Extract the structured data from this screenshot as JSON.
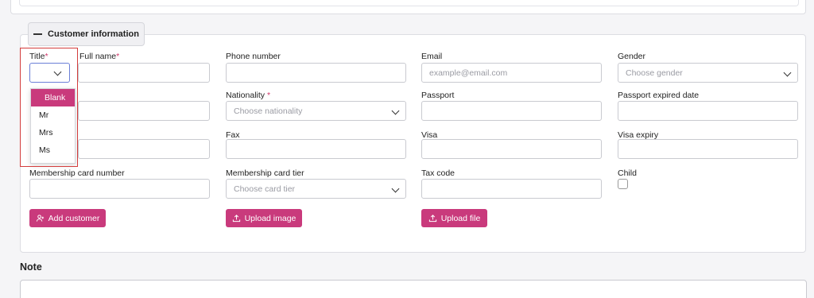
{
  "section": {
    "title": "Customer information"
  },
  "fields": {
    "title": {
      "label": "Title",
      "required": "*"
    },
    "full_name": {
      "label": "Full name",
      "required": "*"
    },
    "phone": {
      "label": "Phone number"
    },
    "email": {
      "label": "Email",
      "placeholder": "example@email.com"
    },
    "gender": {
      "label": "Gender",
      "placeholder": "Choose gender"
    },
    "nationality": {
      "label": "Nationality",
      "required": "*",
      "placeholder": "Choose nationality"
    },
    "passport": {
      "label": "Passport"
    },
    "passport_expiry": {
      "label": "Passport expired date"
    },
    "fax": {
      "label": "Fax"
    },
    "visa": {
      "label": "Visa"
    },
    "visa_expiry": {
      "label": "Visa expiry"
    },
    "membership_number": {
      "label": "Membership card number"
    },
    "membership_tier": {
      "label": "Membership card tier",
      "placeholder": "Choose card tier"
    },
    "tax_code": {
      "label": "Tax code"
    },
    "child": {
      "label": "Child"
    }
  },
  "title_dropdown": {
    "options": [
      "Blank",
      "Mr",
      "Mrs",
      "Ms"
    ],
    "selected": "Blank"
  },
  "buttons": {
    "add_customer": "Add customer",
    "upload_image": "Upload image",
    "upload_file": "Upload file"
  },
  "note": {
    "title": "Note"
  },
  "colors": {
    "accent": "#c93a7c",
    "required": "#d0366a",
    "highlight": "#d33c3c",
    "focus": "#6b7fd7"
  }
}
